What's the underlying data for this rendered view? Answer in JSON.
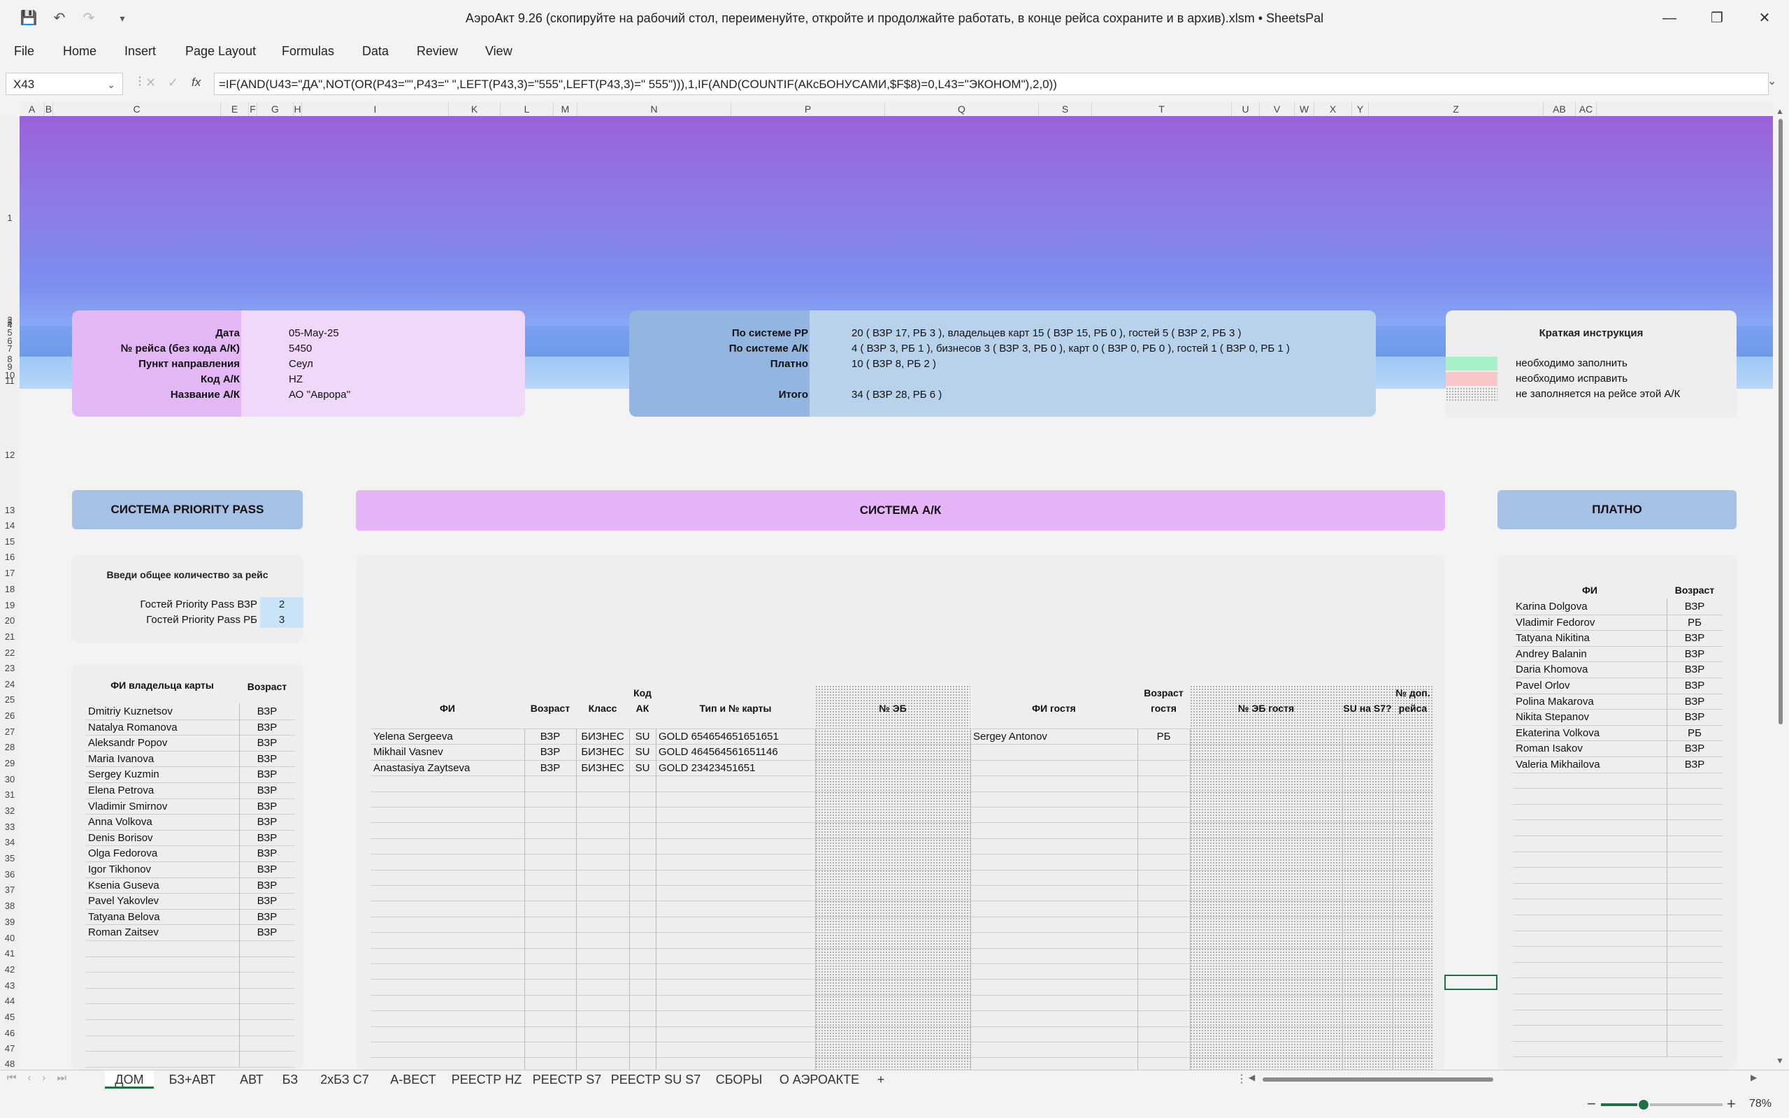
{
  "window": {
    "title": "АэроАкт 9.26 (скопируйте на рабочий стол, переименуйте, откройте и продолжайте работать, в конце рейса сохраните и в архив).xlsm • SheetsPal",
    "minimize": "—",
    "restore": "❐",
    "close": "✕"
  },
  "menu": [
    "File",
    "Home",
    "Insert",
    "Page Layout",
    "Formulas",
    "Data",
    "Review",
    "View"
  ],
  "formula_bar": {
    "name_box": "X43",
    "formula": "=IF(AND(U43=\"ДА\",NOT(OR(P43=\"\",P43=\" \",LEFT(P43,3)=\"555\",LEFT(P43,3)=\" 555\"))),1,IF(AND(COUNTIF(АКсБОНУСАМИ,$F$8)=0,L43=\"ЭКОНОМ\"),2,0))"
  },
  "columns": [
    "A",
    "B",
    "C",
    "E",
    "F",
    "G",
    "H",
    "I",
    "K",
    "L",
    "M",
    "N",
    "P",
    "Q",
    "S",
    "T",
    "U",
    "V",
    "W",
    "X",
    "Y",
    "Z",
    "AB",
    "AC"
  ],
  "rows": [
    "1",
    "2",
    "3",
    "4",
    "5",
    "6",
    "7",
    "8",
    "9",
    "10",
    "11",
    "12",
    "13",
    "14",
    "15",
    "16",
    "17",
    "18",
    "19",
    "20",
    "21",
    "22",
    "23",
    "24",
    "25",
    "26",
    "27",
    "28",
    "29",
    "30",
    "31",
    "32",
    "33",
    "34",
    "35",
    "36",
    "37",
    "38",
    "39",
    "40",
    "41",
    "42",
    "43",
    "44",
    "45",
    "46",
    "47",
    "48"
  ],
  "flight": {
    "labels": [
      "Дата",
      "№ рейса (без кода А/К)",
      "Пункт направления",
      "Код А/К",
      "Название А/К"
    ],
    "values": [
      "05-May-25",
      "5450",
      "Сеул",
      "HZ",
      "АО ''Аврора''"
    ]
  },
  "totals": {
    "labels": [
      "По системе PP",
      "По системе А/К",
      "Платно",
      "Итого"
    ],
    "values": [
      "20 ( ВЗР 17, РБ 3 ), владельцев карт 15 ( ВЗР 15, РБ 0 ), гостей 5 ( ВЗР 2, РБ 3 )",
      "4 ( ВЗР 3, РБ 1 ), бизнесов 3 ( ВЗР 3, РБ 0 ), карт 0 ( ВЗР 0, РБ 0 ), гостей 1 ( ВЗР 0, РБ 1 )",
      "10 ( ВЗР 8, РБ 2 )",
      "34 ( ВЗР 28, РБ 6 )"
    ]
  },
  "legend": {
    "title": "Краткая инструкция",
    "items": [
      {
        "text": "необходимо заполнить",
        "color": "#a8f0c8"
      },
      {
        "text": "необходимо исправить",
        "color": "#f8c8c8"
      },
      {
        "text": "не заполняется на рейсе этой А/К",
        "color": "dotted"
      }
    ]
  },
  "pp": {
    "header": "СИСТЕМА PRIORITY PASS",
    "prompt": "Введи общее количество за рейс",
    "guests_adult_label": "Гостей Priority Pass ВЗР",
    "guests_adult": "2",
    "guests_child_label": "Гостей Priority Pass РБ",
    "guests_child": "3",
    "col_name": "ФИ владельца карты",
    "col_age": "Возраст",
    "rows": [
      [
        "Dmitriy Kuznetsov",
        "ВЗР"
      ],
      [
        "Natalya Romanova",
        "ВЗР"
      ],
      [
        "Aleksandr Popov",
        "ВЗР"
      ],
      [
        "Maria Ivanova",
        "ВЗР"
      ],
      [
        "Sergey Kuzmin",
        "ВЗР"
      ],
      [
        "Elena Petrova",
        "ВЗР"
      ],
      [
        "Vladimir Smirnov",
        "ВЗР"
      ],
      [
        "Anna Volkova",
        "ВЗР"
      ],
      [
        "Denis Borisov",
        "ВЗР"
      ],
      [
        "Olga Fedorova",
        "ВЗР"
      ],
      [
        "Igor Tikhonov",
        "ВЗР"
      ],
      [
        "Ksenia Guseva",
        "ВЗР"
      ],
      [
        "Pavel Yakovlev",
        "ВЗР"
      ],
      [
        "Tatyana Belova",
        "ВЗР"
      ],
      [
        "Roman Zaitsev",
        "ВЗР"
      ]
    ]
  },
  "ak": {
    "header": "СИСТЕМА А/К",
    "cols": [
      "ФИ",
      "Возраст",
      "Класс",
      "Код АК",
      "Тип и № карты",
      "№ ЭБ",
      "ФИ гостя",
      "Возраст гостя",
      "№ ЭБ гостя",
      "SU на S7?",
      "№ доп. рейса"
    ],
    "rows": [
      [
        "Yelena Sergeeva",
        "ВЗР",
        "БИЗНЕС",
        "SU",
        "GOLD 654654651651651",
        "",
        "Sergey Antonov",
        "РБ"
      ],
      [
        "Mikhail Vasnev",
        "ВЗР",
        "БИЗНЕС",
        "SU",
        "GOLD 464564561651146",
        "",
        "",
        ""
      ],
      [
        "Anastasiya Zaytseva",
        "ВЗР",
        "БИЗНЕС",
        "SU",
        "GOLD 23423451651",
        "",
        "",
        ""
      ]
    ]
  },
  "paid": {
    "header": "ПЛАТНО",
    "col_name": "ФИ",
    "col_age": "Возраст",
    "rows": [
      [
        "Karina Dolgova",
        "ВЗР"
      ],
      [
        "Vladimir Fedorov",
        "РБ"
      ],
      [
        "Tatyana Nikitina",
        "ВЗР"
      ],
      [
        "Andrey Balanin",
        "ВЗР"
      ],
      [
        "Daria Khomova",
        "ВЗР"
      ],
      [
        "Pavel Orlov",
        "ВЗР"
      ],
      [
        "Polina Makarova",
        "ВЗР"
      ],
      [
        "Nikita Stepanov",
        "ВЗР"
      ],
      [
        "Ekaterina Volkova",
        "РБ"
      ],
      [
        "Roman Isakov",
        "ВЗР"
      ],
      [
        "Valeria Mikhailova",
        "ВЗР"
      ]
    ]
  },
  "tabs": [
    "ДОМ",
    "БЗ+АВТ",
    "АВТ",
    "БЗ",
    "2хБЗ С7",
    "А-ВЕСТ",
    "РЕЕСТР HZ",
    "РЕЕСТР S7",
    "РЕЕСТР SU S7",
    "СБОРЫ",
    "О АЭРОАКТЕ",
    "+"
  ],
  "active_tab": "ДОМ",
  "zoom": "78%"
}
